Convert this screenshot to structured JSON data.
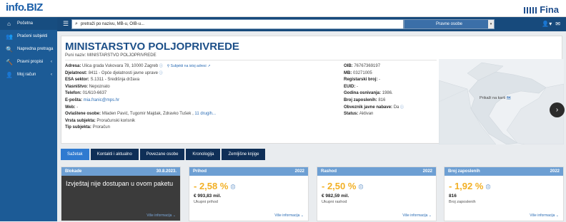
{
  "brand": {
    "logo_prefix": "info",
    "logo_suffix": "BIZ",
    "partner": "Fina"
  },
  "sidebar": {
    "items": [
      {
        "label": "Početna",
        "icon": "home-icon"
      },
      {
        "label": "Praćeni subjekti",
        "icon": "users-icon"
      },
      {
        "label": "Napredna pretraga",
        "icon": "search-icon"
      },
      {
        "label": "Pravni propisi",
        "icon": "gavel-icon"
      },
      {
        "label": "Moj račun",
        "icon": "user-icon"
      }
    ]
  },
  "navbar": {
    "search_placeholder": "pretraži po nazivu, MB-u, OIB-u...",
    "entity_type": "Pravne osobe"
  },
  "company": {
    "name": "MINISTARSTVO POLJOPRIVREDE",
    "full_name_label": "Puni naziv:",
    "full_name": "MINISTARSTVO POLJOPRIVREDE",
    "address_label": "Adresa:",
    "address": "Ulica grada Vukovara 78, 10000 Zagreb",
    "same_address_link": "Subjekti na istoj adresi",
    "activity_label": "Djelatnost:",
    "activity": "8411 - Opće djelatnosti javne uprave",
    "esa_label": "ESA sektor:",
    "esa": "S.1311 - Središnja država",
    "ownership_label": "Vlasništvo:",
    "ownership": "Nepoznato",
    "phone_label": "Telefon:",
    "phone": "01/610-6637",
    "email_label": "E-pošta:",
    "email": "mia.franic@mps.hr",
    "web_label": "Web:",
    "web": "-",
    "authorized_label": "Ovlaštene osobe:",
    "authorized": "Mladen Pavić, Tugomir Majdak, Zdravko Tušek ,",
    "authorized_more": "11 drugih...",
    "subject_kind_label": "Vrsta subjekta:",
    "subject_kind": "Proračunski korisnik",
    "subject_type_label": "Tip subjekta:",
    "subject_type": "Proračun",
    "oib_label": "OIB:",
    "oib": "76767369197",
    "mb_label": "MB:",
    "mb": "03271005",
    "reg_label": "Registarski broj:",
    "reg": "-",
    "euid_label": "EUID:",
    "euid": "-",
    "founded_label": "Godina osnivanja:",
    "founded": "1986.",
    "employees_label": "Broj zaposlenih:",
    "employees": "816",
    "procurement_label": "Obveznik javne nabave:",
    "procurement": "Da",
    "status_label": "Status:",
    "status": "Aktivan"
  },
  "map": {
    "label": "Prikaži na karti"
  },
  "tabs": [
    "Sažetak",
    "Kontakti i aktualno",
    "Povezane osobe",
    "Kronologija",
    "Zemljišne knjige"
  ],
  "boxes": {
    "blokade": {
      "title": "Blokade",
      "date": "30.8.2023.",
      "text": "Izvještaj nije dostupan u ovom paketu",
      "more": "Više informacija"
    },
    "prihod": {
      "title": "Prihod",
      "year": "2022",
      "pct": "- 2,58 %",
      "amount": "€ 993,83 mil.",
      "sub": "Ukupni prihod",
      "more": "Više informacija"
    },
    "rashod": {
      "title": "Rashod",
      "year": "2022",
      "pct": "- 2,50 %",
      "amount": "€ 982,59 mil.",
      "sub": "Ukupni rashod",
      "more": "Više informacija"
    },
    "zaposleni": {
      "title": "Broj zaposlenih",
      "year": "2022",
      "pct": "- 1,92 %",
      "amount": "816",
      "sub": "Broj zaposlenih",
      "more": "Više informacija"
    }
  },
  "colors": {
    "sidebar": "#1c5b96",
    "navbar": "#174a7c",
    "accent": "#2f7ad0",
    "warning": "#f2b025"
  }
}
